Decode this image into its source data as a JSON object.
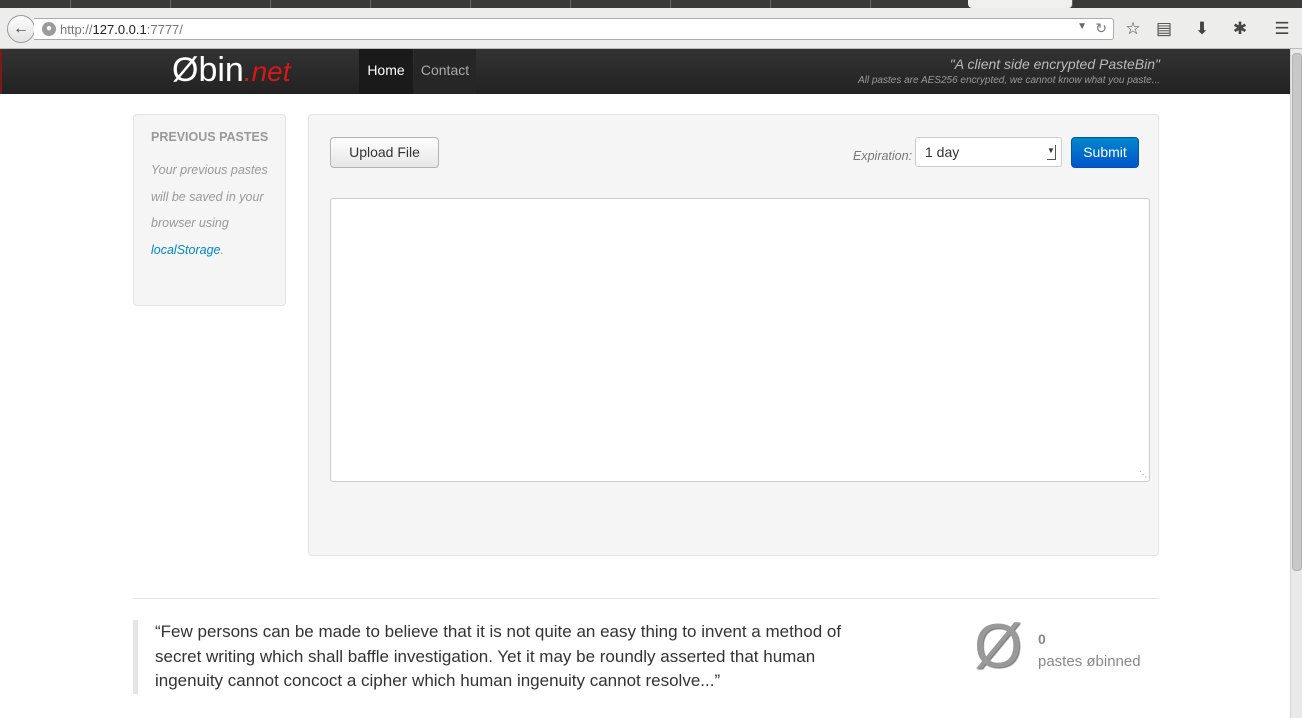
{
  "browser": {
    "url_prefix": "http://",
    "url_host": "127.0.0.1",
    "url_suffix": ":7777/"
  },
  "nav": {
    "brand_main": "Øbin",
    "brand_tld": ".net",
    "items": [
      {
        "label": "Home"
      },
      {
        "label": "Contact"
      }
    ],
    "tagline": "\"A client side encrypted PasteBin\"",
    "subtagline": "All pastes are AES256 encrypted, we cannot know what you paste..."
  },
  "sidebar": {
    "title": "PREVIOUS PASTES",
    "text": "Your previous pastes will be saved in your browser using ",
    "link": "localStorage",
    "text_end": "."
  },
  "form": {
    "upload_label": "Upload File",
    "expiration_label": "Expiration:",
    "expiration_value": "1 day",
    "submit_label": "Submit",
    "paste_text": ""
  },
  "footer": {
    "quote": "“Few persons can be made to believe that it is not quite an easy thing to invent a method of secret writing which shall baffle investigation. Yet it may be roundly asserted that human ingenuity cannot concoct a cipher which human ingenuity cannot resolve...”",
    "logo_glyph": "Ø",
    "paste_count": "0",
    "paste_count_label": "pastes øbinned"
  }
}
